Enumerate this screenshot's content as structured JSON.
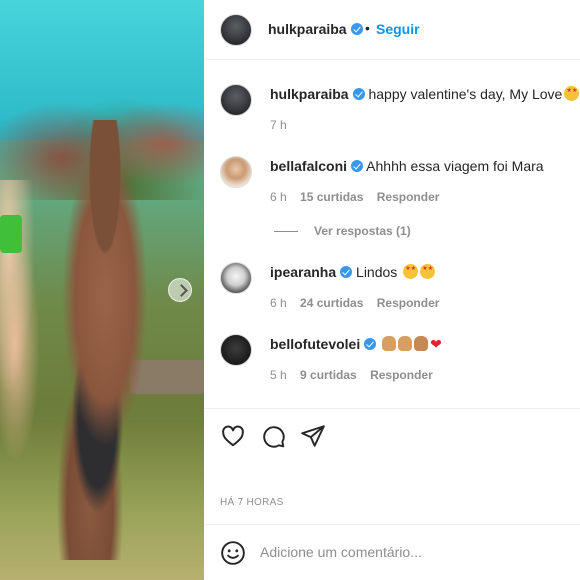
{
  "post": {
    "author": "hulkparaiba",
    "separator": "•",
    "follow_label": "Seguir",
    "caption_user": "hulkparaiba",
    "caption_text": "happy valentine's day, My Love",
    "caption_time": "7 h",
    "posted_label": "HÁ 7 HORAS",
    "add_comment_placeholder": "Adicione um comentário..."
  },
  "comments": [
    {
      "user": "bellafalconi",
      "verified": true,
      "text": "Ahhhh essa viagem foi Mara",
      "time": "6 h",
      "likes": "15 curtidas",
      "reply": "Responder",
      "view_replies": "Ver respostas (1)"
    },
    {
      "user": "ipearanha",
      "verified": true,
      "text": "Lindos",
      "time": "6 h",
      "likes": "24 curtidas",
      "reply": "Responder"
    },
    {
      "user": "bellofutevolei",
      "verified": true,
      "text": "",
      "time": "5 h",
      "likes": "9 curtidas",
      "reply": "Responder"
    }
  ],
  "icons": {
    "like": "heart-icon",
    "comment": "comment-icon",
    "share": "send-icon",
    "emoji": "smiley-icon"
  },
  "colors": {
    "accent": "#0095f6",
    "verified": "#3897f0",
    "muted": "#8e8e8e",
    "text": "#262626"
  }
}
